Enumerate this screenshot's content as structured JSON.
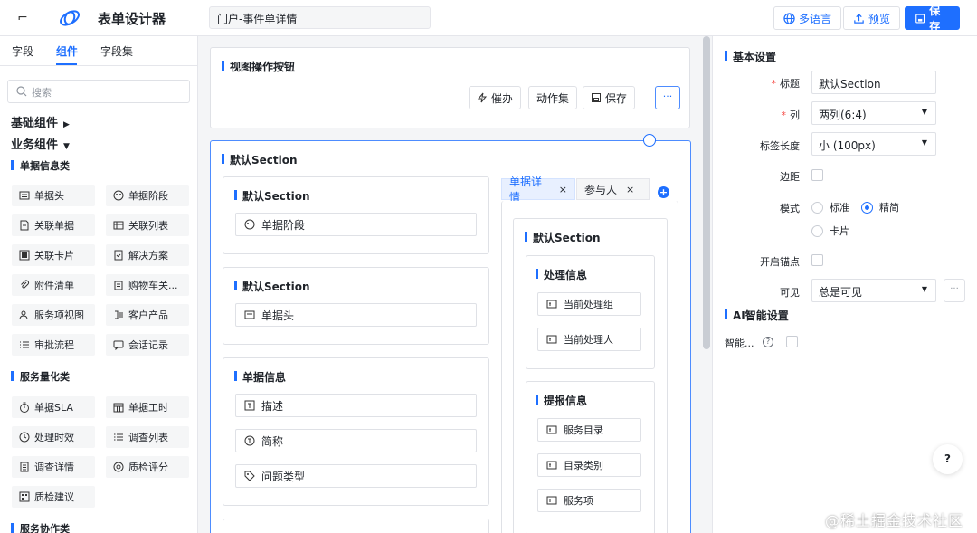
{
  "header": {
    "title": "表单设计器",
    "form_name": "门户-事件单详情",
    "buttons": {
      "lang": "多语言",
      "preview": "预览",
      "save": "保存"
    }
  },
  "left": {
    "tabs": [
      "字段",
      "组件",
      "字段集"
    ],
    "active_tab": "组件",
    "search_placeholder": "搜索",
    "groups": [
      "基础组件",
      "业务组件"
    ],
    "categories": [
      "单据信息类",
      "服务量化类",
      "服务协作类"
    ],
    "doc_items": [
      "单据头",
      "单据阶段",
      "关联单据",
      "关联列表",
      "关联卡片",
      "解决方案",
      "附件清单",
      "购物车关...",
      "服务项视图",
      "客户产品",
      "审批流程",
      "会话记录"
    ],
    "quant_items": [
      "单据SLA",
      "单据工时",
      "处理时效",
      "调查列表",
      "调查详情",
      "质检评分",
      "质检建议"
    ]
  },
  "canvas": {
    "view_buttons": {
      "title": "视图操作按钮",
      "urge": "催办",
      "action_set": "动作集",
      "save": "保存",
      "more": "···"
    },
    "main_section_title": "默认Section",
    "sub1": {
      "title": "默认Section",
      "field": "单据阶段"
    },
    "sub2": {
      "title": "默认Section",
      "field": "单据头"
    },
    "sub3": {
      "title": "单据信息",
      "fields": [
        "描述",
        "简称",
        "问题类型"
      ]
    },
    "tabs": [
      "单据详情",
      "参与人"
    ],
    "tab_close": "×",
    "tab_section_title": "默认Section",
    "processing": {
      "title": "处理信息",
      "fields": [
        "当前处理组",
        "当前处理人"
      ]
    },
    "report": {
      "title": "提报信息",
      "fields": [
        "服务目录",
        "目录类别",
        "服务项"
      ]
    }
  },
  "right": {
    "basic_title": "基本设置",
    "labels": {
      "title": "标题",
      "columns": "列",
      "label_length": "标签长度",
      "margin": "边距",
      "mode": "模式",
      "anchor": "开启锚点",
      "visible": "可见"
    },
    "values": {
      "title": "默认Section",
      "columns": "两列(6:4)",
      "label_length": "小 (100px)",
      "visible": "总是可见"
    },
    "mode_options": [
      "标准",
      "精简",
      "卡片"
    ],
    "mode_selected": "精简",
    "ai_title": "AI智能设置",
    "ai_label": "智能...",
    "ellipsis": "···"
  },
  "help": "?",
  "watermark": "@稀土掘金技术社区",
  "colors": {
    "accent": "#1e6fff",
    "required": "#f54a45"
  }
}
